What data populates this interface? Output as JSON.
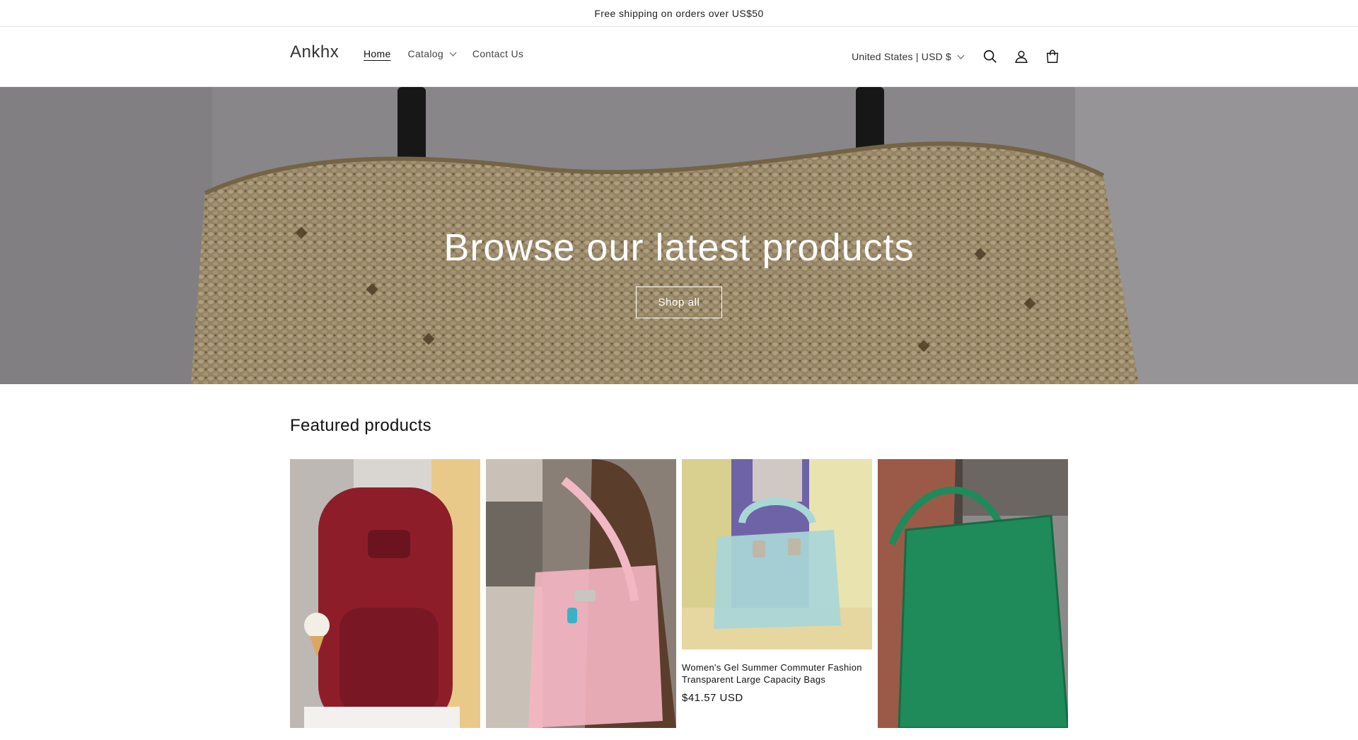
{
  "announcement": {
    "text": "Free shipping on orders over US$50"
  },
  "header": {
    "logo": "Ankhx",
    "nav": [
      {
        "label": "Home",
        "active": true
      },
      {
        "label": "Catalog",
        "has_dropdown": true
      },
      {
        "label": "Contact Us"
      }
    ],
    "country_selector": "United States | USD $",
    "icons": [
      "search-icon",
      "account-icon",
      "cart-icon"
    ]
  },
  "hero": {
    "title": "Browse our latest products",
    "button_label": "Shop all"
  },
  "featured": {
    "title": "Featured products",
    "products": [
      {
        "image": "red-backpack",
        "title": "",
        "price": ""
      },
      {
        "image": "pink-jelly-tote",
        "title": "",
        "price": ""
      },
      {
        "image": "light-blue-jelly-bag",
        "title": "Women's Gel Summer Commuter Fashion Transparent Large Capacity Bags",
        "price": "$41.57 USD"
      },
      {
        "image": "green-woven-tote",
        "title": "",
        "price": ""
      }
    ]
  },
  "colors": {
    "text": "#121212",
    "border": "#e4e4e4",
    "hero_text": "#ffffff"
  }
}
